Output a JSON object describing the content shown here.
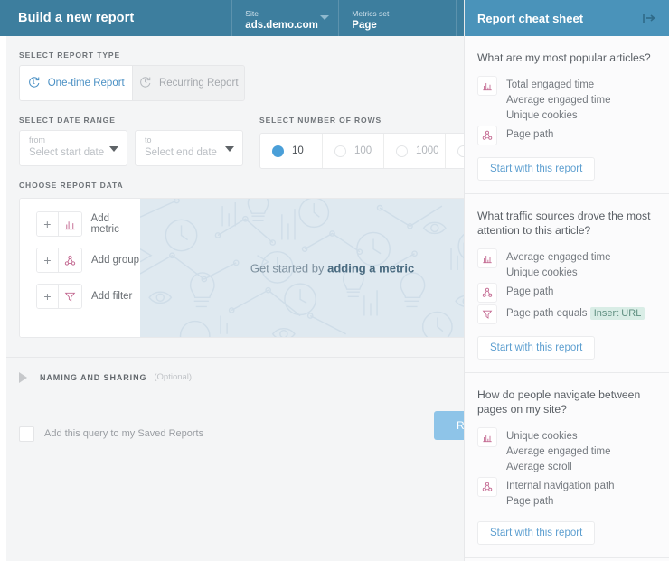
{
  "header": {
    "title": "Build a new report",
    "site": {
      "label": "Site",
      "value": "ads.demo.com"
    },
    "metrics_set": {
      "label": "Metrics set",
      "value": "Page"
    }
  },
  "report_type": {
    "section_label": "SELECT REPORT TYPE",
    "options": [
      {
        "label": "One-time Report",
        "icon": "one-time-icon",
        "selected": true
      },
      {
        "label": "Recurring Report",
        "icon": "recurring-icon",
        "selected": false
      }
    ]
  },
  "date_range": {
    "section_label": "SELECT DATE RANGE",
    "from": {
      "label": "from",
      "placeholder": "Select start date"
    },
    "to": {
      "label": "to",
      "placeholder": "Select end date"
    }
  },
  "rows": {
    "section_label": "SELECT NUMBER OF ROWS",
    "options": [
      "10",
      "100",
      "1000",
      ""
    ],
    "selected": "10"
  },
  "report_data": {
    "section_label": "CHOOSE REPORT DATA",
    "actions": [
      {
        "label": "Add metric",
        "icon": "bar-chart-icon",
        "plus": "+"
      },
      {
        "label": "Add group",
        "icon": "node-graph-icon",
        "plus": "+"
      },
      {
        "label": "Add filter",
        "icon": "funnel-icon",
        "plus": "+"
      }
    ],
    "empty_prefix": "Get started by ",
    "empty_emphasis": "adding a metric"
  },
  "naming": {
    "title": "NAMING AND SHARING",
    "optional": "(Optional)"
  },
  "footer": {
    "save_label": "Add this query to my Saved Reports",
    "run_label": "Run"
  },
  "panel": {
    "title": "Report cheat sheet",
    "collapse_icon": "collapse-panel-icon",
    "sections": [
      {
        "question": "What are my most popular articles?",
        "groups": [
          {
            "icon": "bar-chart-icon",
            "items": [
              "Total engaged time",
              "Average engaged time",
              "Unique cookies"
            ]
          },
          {
            "icon": "node-graph-icon",
            "items": [
              "Page path"
            ]
          }
        ],
        "button": "Start with this report"
      },
      {
        "question": "What traffic sources drove the most attention to this article?",
        "groups": [
          {
            "icon": "bar-chart-icon",
            "items": [
              "Average engaged time",
              "Unique cookies"
            ]
          },
          {
            "icon": "node-graph-icon",
            "items": [
              "Page path"
            ]
          },
          {
            "icon": "funnel-icon",
            "items": [
              "Page path equals"
            ],
            "pill": "Insert URL"
          }
        ],
        "button": "Start with this report"
      },
      {
        "question": "How do people navigate between pages on my site?",
        "groups": [
          {
            "icon": "bar-chart-icon",
            "items": [
              "Unique cookies",
              "Average engaged time",
              "Average scroll"
            ]
          },
          {
            "icon": "node-graph-icon",
            "items": [
              "Internal navigation path",
              "Page path"
            ]
          }
        ],
        "button": "Start with this report"
      }
    ]
  },
  "colors": {
    "header_blue": "#3d7e9e",
    "panel_blue": "#4a93ba",
    "accent_blue": "#4a90c4",
    "icon_pink": "#c2668f",
    "illustration_bg": "#dfe9f0",
    "pill_green": "#d9ede6"
  }
}
